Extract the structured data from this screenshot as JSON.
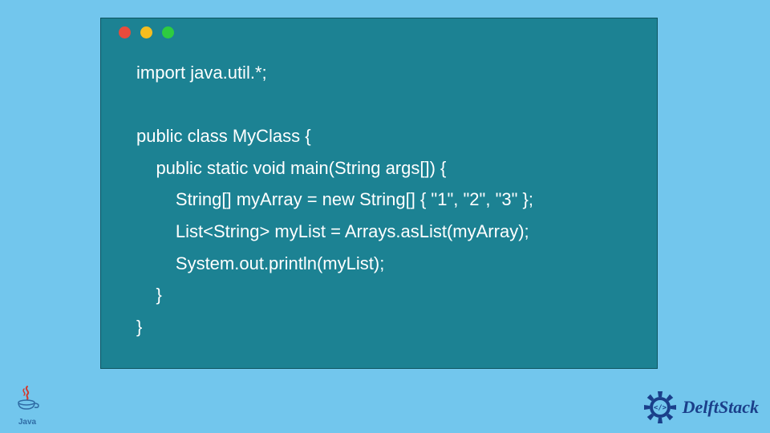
{
  "code": {
    "lines": [
      "import java.util.*;",
      "",
      "public class MyClass {",
      "    public static void main(String args[]) {",
      "        String[] myArray = new String[] { \"1\", \"2\", \"3\" };",
      "        List<String> myList = Arrays.asList(myArray);",
      "        System.out.println(myList);",
      "    }",
      "}"
    ]
  },
  "window_dots": {
    "red": "#e94b3c",
    "yellow": "#f5bd1f",
    "green": "#2ecc40"
  },
  "logos": {
    "java_label": "Java",
    "delft_label": "DelftStack"
  }
}
